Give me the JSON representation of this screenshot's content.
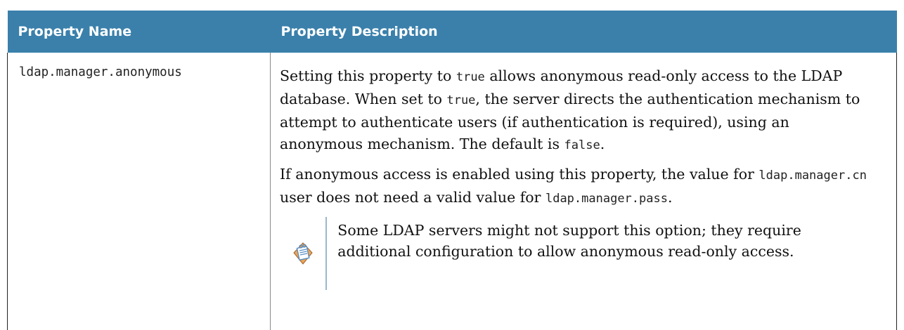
{
  "table": {
    "headers": [
      "Property Name",
      "Property Description"
    ],
    "row": {
      "property_name": "ldap.manager.anonymous",
      "description": {
        "p1": {
          "t1": "Setting this property to ",
          "c1": "true",
          "t2": " allows anonymous read-only access to the LDAP database. When set to ",
          "c2": "true",
          "t3": ", the server directs the authentication mechanism to attempt to authenticate users (if authentication is required), using an anonymous mechanism. The default is ",
          "c3": "false",
          "t4": "."
        },
        "p2": {
          "t1": "If anonymous access is enabled using this property, the value for ",
          "c1": "ldap.manager.cn",
          "t2": " user does not need a valid value for ",
          "c2": "ldap.manager.pass",
          "t3": "."
        },
        "note": {
          "icon": "note-icon",
          "text": "Some LDAP servers might not support this option; they require additional configuration to allow anonymous read-only access."
        }
      }
    }
  },
  "colors": {
    "header_bg": "#3a80ab",
    "header_text": "#ffffff",
    "note_rule": "#9ab6cc"
  }
}
